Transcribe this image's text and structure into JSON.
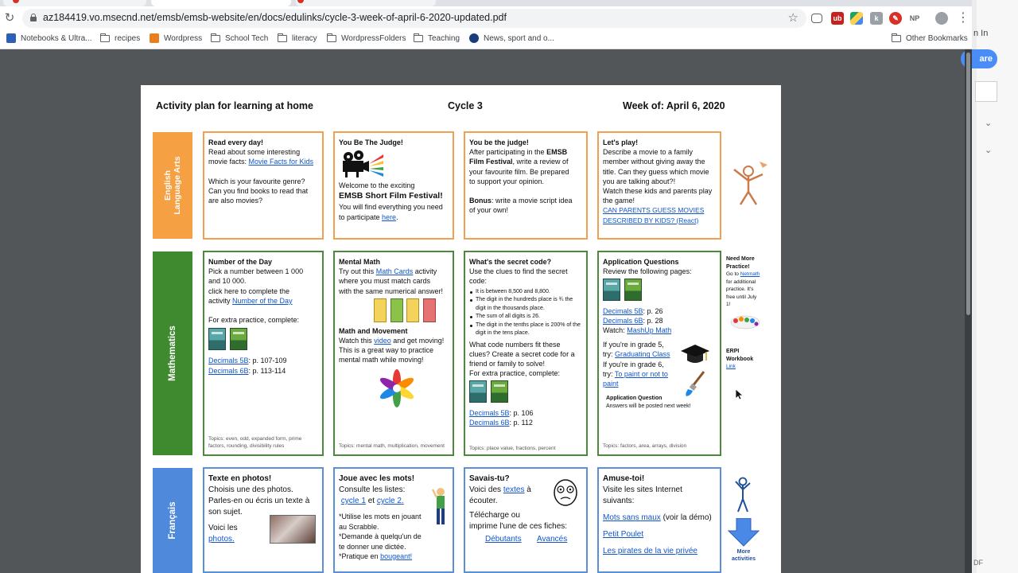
{
  "browser": {
    "url": "az184419.vo.msecnd.net/emsb/emsb-website/en/docs/edulinks/cycle-3-week-of-april-6-2020-updated.pdf",
    "bookmarks": [
      {
        "label": "Notebooks & Ultra...",
        "icon": "notebooks-favicon"
      },
      {
        "label": "recipes",
        "icon": "folder-icon"
      },
      {
        "label": "Wordpress",
        "icon": "wordpress-favicon"
      },
      {
        "label": "School Tech",
        "icon": "folder-icon"
      },
      {
        "label": "literacy",
        "icon": "folder-icon"
      },
      {
        "label": "WordpressFolders",
        "icon": "folder-icon"
      },
      {
        "label": "Teaching",
        "icon": "folder-icon"
      },
      {
        "label": "News, sport and o...",
        "icon": "news-favicon"
      }
    ],
    "other_bookmarks": "Other Bookmarks",
    "extension_np": "NP",
    "right_pane": {
      "sign_in": "n In",
      "share": "are",
      "footer": "DF"
    }
  },
  "doc": {
    "header": {
      "title": "Activity plan for learning at home",
      "cycle": "Cycle 3",
      "week": "Week of: April 6, 2020"
    },
    "subjects": {
      "ela_line1": "English",
      "ela_line2": "Language Arts",
      "math": "Mathematics",
      "french": "Français"
    },
    "ela": {
      "c1": {
        "title": "Read every day!",
        "l1": "Read about some interesting",
        "l2": "movie facts:",
        "link": "Movie Facts for Kids",
        "l3": "Which is your favourite genre?",
        "l4": "Can you find books to read that",
        "l5": "are also movies?"
      },
      "c2": {
        "title": "You Be The Judge!",
        "l1": "Welcome to the exciting",
        "big": "EMSB Short Film Festival!",
        "l2": "You will find everything you need",
        "l3": "to participate",
        "link": "here"
      },
      "c3": {
        "title": "You be the judge!",
        "l1a": "After participating in the",
        "l1b": "EMSB",
        "l2b": "Film Festival",
        "l2a": ", write a review of",
        "l3": "your favourite film. Be prepared",
        "l4": "to support your opinion.",
        "bonus": "Bonus",
        "l5": ": write a movie script idea",
        "l6": "of your own!"
      },
      "c4": {
        "title": "Let's play!",
        "l1": "Describe a movie to a family",
        "l2": "member without giving away the",
        "l3": "title. Can they guess which movie",
        "l4": "you are talking about?!",
        "l5": "Watch these kids and parents play",
        "l6": "the game!",
        "link1": "CAN PARENTS GUESS MOVIES",
        "link2": "DESCRIBED BY KIDS? (React)"
      }
    },
    "math": {
      "c1": {
        "title": "Number of the Day",
        "l1": "Pick a number between 1 000",
        "l2": "and 10 000.",
        "l3": "click here to complete the",
        "l4": "activity",
        "link": "Number of the Day",
        "l5": "For extra practice, complete:",
        "ref1_link": "Decimals 5B",
        "ref1": ": p. 107-109",
        "ref2_link": "Decimals 6B",
        "ref2": ": p. 113-114",
        "topics": "Topics: even, odd, expanded form, prime factors, rounding, divisibility rules"
      },
      "c2": {
        "title": "Mental Math",
        "l1a": "Try out this",
        "link1": "Math Cards",
        "l1b": "activity",
        "l2": "where you must match cards",
        "l3": "with the same numerical answer!",
        "title2": "Math and Movement",
        "l4a": "Watch this",
        "link2": "video",
        "l4b": "and get moving!",
        "l5": "This is a great way to practice",
        "l6": "mental math while moving!",
        "topics": "Topics: mental math, multiplication, movement"
      },
      "c3": {
        "title": "What's the secret code?",
        "l1": "Use the clues to find the secret",
        "l2": "code:",
        "clues": [
          "It is between 8,500 and 8,800.",
          "The digit in the hundreds place is ¾ the digit in the thousands place.",
          "The sum of all digits is 26.",
          "The digit in the tenths place is 200% of the digit in the tens place."
        ],
        "l3": "What code numbers fit these",
        "l4": "clues? Create a secret code for a",
        "l5": "friend or family to solve!",
        "l6": "For extra practice, complete:",
        "ref1_link": "Decimals 5B",
        "ref1": ": p. 106",
        "ref2_link": "Decimals 6B",
        "ref2": ": p. 112",
        "topics": "Topics: place value, fractions, percent"
      },
      "c4": {
        "title": "Application Questions",
        "l1": "Review the following pages:",
        "ref1_link": "Decimals 5B",
        "ref1": ": p. 26",
        "ref2_link": "Decimals 6B",
        "ref2": ": p. 28",
        "watch": "Watch:",
        "link3": "MashUp Math",
        "l2": "If you're in grade 5,",
        "l3": "try:",
        "link4": "Graduating Class",
        "l4": "If you're in grade 6,",
        "l5": "try:",
        "link5a": "To paint or not to",
        "link5b": "paint",
        "aq": "Application Question",
        "aq2": "Answers will be posted next week!",
        "topics": "Topics: factors, area, arrays, division"
      },
      "side": {
        "need1": "Need More",
        "need2": "Practice!",
        "go": "Go to",
        "netmath": "Netmath",
        "r1": "for additional",
        "r2": "practice. It's",
        "r3": "free until July",
        "r4": "1!",
        "erpi1": "ERPI",
        "erpi2": "Workbook",
        "erpi_link": "Link"
      }
    },
    "fr": {
      "c1": {
        "title": "Texte en photos!",
        "l1": "Choisis une des photos.",
        "l2": "Parles-en ou écris un texte à",
        "l3": "son sujet.",
        "l4": "Voici les",
        "link": "photos."
      },
      "c2": {
        "title": "Joue avec les mots!",
        "l1": "Consulte les listes:",
        "link1": "cycle 1",
        "et": "et",
        "link2": "cycle 2.",
        "l2": "*Utilise les mots en jouant",
        "l3": "au Scrabble.",
        "l4": "*Demande à quelqu'un de",
        "l5": "te donner une dictée.",
        "l6": "*Pratique en",
        "link3": "bougeant!"
      },
      "c3": {
        "title": "Savais-tu?",
        "l1a": "Voici des",
        "link1": "textes",
        "l1b": "à",
        "l2": "écouter.",
        "l3": "Télécharge ou",
        "l4": "imprime l'une de ces fiches:",
        "link2": "Débutants",
        "link3": "Avancés"
      },
      "c4": {
        "title": "Amuse-toi!",
        "l1": "Visite les sites Internet",
        "l2": "suivants:",
        "link1": "Mots sans maux",
        "l3": "(voir  la démo)",
        "link2": "Petit Poulet",
        "link3": "Les pirates de la vie privée"
      },
      "side": {
        "more1": "More",
        "more2": "activities"
      }
    }
  },
  "colors": {
    "ela": "#f0a050",
    "math": "#4a8a3a",
    "french": "#5b8fd6",
    "ela_bar": "#f4a043",
    "math_bar": "#3f8a2e",
    "fr_bar": "#4f89dc",
    "link": "#1155cc",
    "viewer_bg": "#525659"
  }
}
